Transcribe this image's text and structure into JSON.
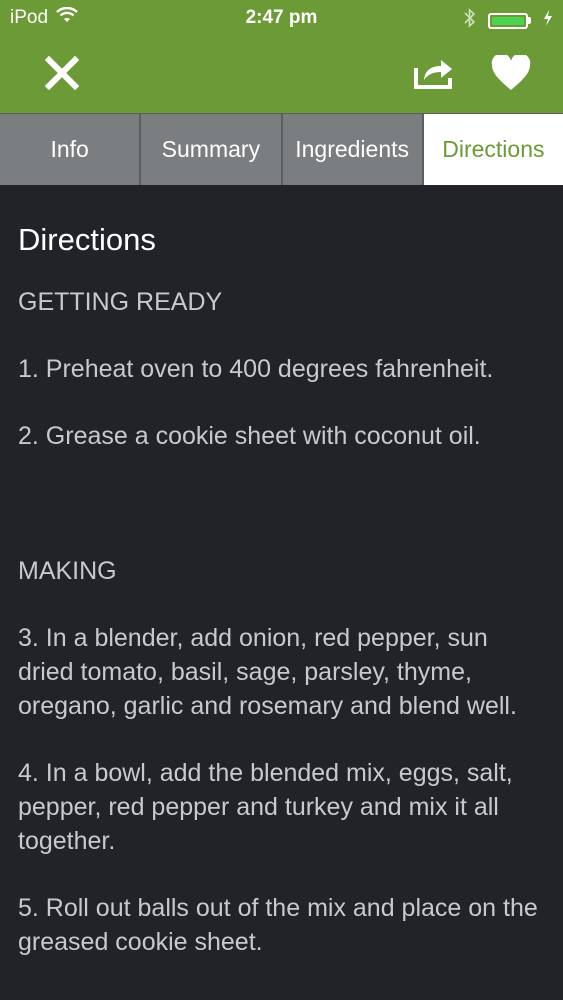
{
  "status_bar": {
    "carrier": "iPod",
    "time": "2:47 pm",
    "icons": [
      "wifi-icon",
      "bluetooth-icon",
      "battery-icon",
      "charging-icon"
    ]
  },
  "navbar": {
    "icons": [
      "close-icon",
      "share-icon",
      "heart-icon"
    ],
    "color": "#6c9a36"
  },
  "tabs": [
    {
      "label": "Info"
    },
    {
      "label": "Summary"
    },
    {
      "label": "Ingredients"
    },
    {
      "label": "Directions",
      "active": true
    }
  ],
  "content": {
    "title": "Directions",
    "sections": [
      {
        "heading": "GETTING READY",
        "steps": [
          "1. Preheat oven to 400 degrees fahrenheit.",
          "2. Grease a cookie sheet with coconut oil."
        ]
      },
      {
        "heading": "MAKING",
        "steps": [
          "3. In a blender, add onion, red pepper, sun dried tomato, basil, sage, parsley, thyme, oregano, garlic and rosemary and blend well.",
          "4. In a bowl, add the blended mix, eggs, salt, pepper, red pepper and turkey and mix it all together.",
          "5. Roll out balls out of the mix and place on the greased cookie sheet."
        ]
      }
    ]
  },
  "colors": {
    "accent": "#6c9a36",
    "background": "#222329",
    "tab_inactive": "#7a7e80"
  }
}
